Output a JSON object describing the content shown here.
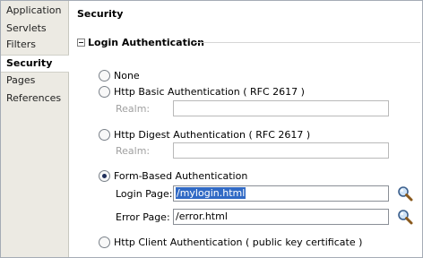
{
  "sidebar": {
    "items": [
      {
        "label": "Application"
      },
      {
        "label": "Servlets"
      },
      {
        "label": "Filters"
      },
      {
        "label": "Security"
      },
      {
        "label": "Pages"
      },
      {
        "label": "References"
      }
    ],
    "selected": "Security"
  },
  "main": {
    "title": "Security",
    "section": {
      "title": "Login Authentication",
      "options": [
        {
          "label": "None",
          "checked": false
        },
        {
          "label": "Http Basic Authentication ( RFC 2617 )",
          "checked": false
        },
        {
          "label": "Http Digest Authentication ( RFC 2617 )",
          "checked": false
        },
        {
          "label": "Form-Based Authentication",
          "checked": true
        },
        {
          "label": "Http Client Authentication ( public key certificate )",
          "checked": false
        }
      ],
      "basic_realm": {
        "label": "Realm:",
        "value": ""
      },
      "digest_realm": {
        "label": "Realm:",
        "value": ""
      },
      "login_page": {
        "label": "Login Page:",
        "value": "/mylogin.html"
      },
      "error_page": {
        "label": "Error Page:",
        "value": "/error.html"
      }
    }
  },
  "icons": {
    "search": "magnifier-icon",
    "collapse": "collapse-minus-icon"
  },
  "colors": {
    "sidebar_bg": "#eceae3",
    "selection": "#316ac5"
  }
}
